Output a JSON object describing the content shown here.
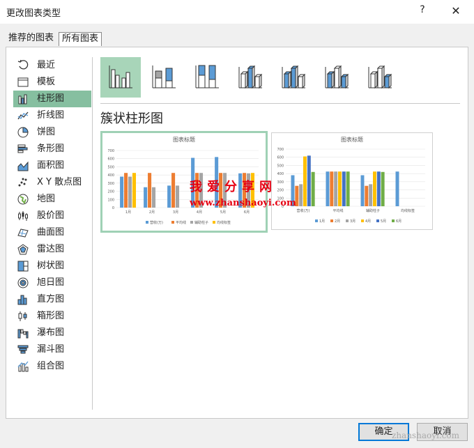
{
  "window": {
    "title": "更改图表类型",
    "help_label": "?",
    "close_label": "✕"
  },
  "tabs": [
    {
      "label": "推荐的图表",
      "selected": false
    },
    {
      "label": "所有图表",
      "selected": true
    }
  ],
  "sidebar": {
    "items": [
      {
        "label": "最近",
        "icon": "recent-icon"
      },
      {
        "label": "模板",
        "icon": "template-icon"
      },
      {
        "label": "柱形图",
        "icon": "column-chart-icon",
        "selected": true
      },
      {
        "label": "折线图",
        "icon": "line-chart-icon"
      },
      {
        "label": "饼图",
        "icon": "pie-chart-icon"
      },
      {
        "label": "条形图",
        "icon": "bar-chart-icon"
      },
      {
        "label": "面积图",
        "icon": "area-chart-icon"
      },
      {
        "label": "X Y 散点图",
        "icon": "scatter-chart-icon"
      },
      {
        "label": "地图",
        "icon": "map-chart-icon"
      },
      {
        "label": "股价图",
        "icon": "stock-chart-icon"
      },
      {
        "label": "曲面图",
        "icon": "surface-chart-icon"
      },
      {
        "label": "雷达图",
        "icon": "radar-chart-icon"
      },
      {
        "label": "树状图",
        "icon": "treemap-chart-icon"
      },
      {
        "label": "旭日图",
        "icon": "sunburst-chart-icon"
      },
      {
        "label": "直方图",
        "icon": "histogram-chart-icon"
      },
      {
        "label": "箱形图",
        "icon": "box-whisker-chart-icon"
      },
      {
        "label": "瀑布图",
        "icon": "waterfall-chart-icon"
      },
      {
        "label": "漏斗图",
        "icon": "funnel-chart-icon"
      },
      {
        "label": "组合图",
        "icon": "combo-chart-icon"
      }
    ]
  },
  "subtypes": [
    {
      "icon": "clustered-column-icon",
      "selected": true
    },
    {
      "icon": "stacked-column-icon"
    },
    {
      "icon": "100-stacked-column-icon"
    },
    {
      "icon": "3d-clustered-column-icon"
    },
    {
      "icon": "3d-stacked-column-icon"
    },
    {
      "icon": "3d-100-stacked-column-icon"
    },
    {
      "icon": "3d-column-icon"
    }
  ],
  "selected_type_title": "簇状柱形图",
  "colors": {
    "blue": "#5b9bd5",
    "orange": "#ed7d31",
    "gray": "#a5a5a5",
    "gold": "#ffc000",
    "darkblue": "#4472c4",
    "green": "#70ad47",
    "accent": "#86bfa0"
  },
  "watermark": {
    "title": "我爱分享网",
    "url": "www.zhanshaoyi.com",
    "corner": "zhanshaoyi.com"
  },
  "buttons": {
    "ok": "确定",
    "cancel": "取消"
  },
  "chart_data": [
    {
      "type": "bar",
      "title": "图表标题",
      "categories": [
        "1月",
        "2月",
        "3月",
        "4月",
        "5月",
        "6月"
      ],
      "ylim": [
        0,
        700
      ],
      "yticks": [
        0,
        100,
        200,
        300,
        400,
        500,
        600,
        700
      ],
      "series": [
        {
          "name": "营收(万)",
          "values": [
            380,
            250,
            270,
            610,
            620,
            420
          ]
        },
        {
          "name": "平均线",
          "values": [
            425,
            425,
            425,
            425,
            425,
            425
          ]
        },
        {
          "name": "辅助柱子",
          "values": [
            380,
            250,
            270,
            425,
            425,
            420
          ]
        },
        {
          "name": "均线标签",
          "values": [
            425,
            0,
            0,
            0,
            0,
            425
          ]
        }
      ],
      "legend": "bottom",
      "grid": true
    },
    {
      "type": "bar",
      "title": "图表标题",
      "categories": [
        "营收(万)",
        "平均线",
        "辅助柱子",
        "均线标签"
      ],
      "ylim": [
        0,
        700
      ],
      "yticks": [
        0,
        100,
        200,
        300,
        400,
        500,
        600,
        700
      ],
      "series": [
        {
          "name": "1月",
          "values": [
            380,
            425,
            380,
            425
          ]
        },
        {
          "name": "2月",
          "values": [
            250,
            425,
            250,
            0
          ]
        },
        {
          "name": "3月",
          "values": [
            270,
            425,
            270,
            0
          ]
        },
        {
          "name": "4月",
          "values": [
            610,
            425,
            425,
            0
          ]
        },
        {
          "name": "5月",
          "values": [
            620,
            425,
            425,
            0
          ]
        },
        {
          "name": "6月",
          "values": [
            420,
            425,
            420,
            0
          ]
        }
      ],
      "legend": "bottom",
      "grid": true
    }
  ]
}
